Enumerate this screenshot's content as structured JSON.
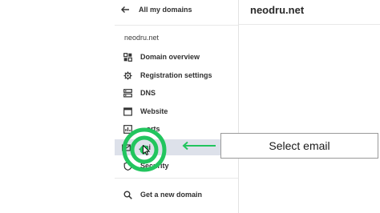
{
  "header": {
    "back_label": "All my domains",
    "domain_title": "neodru.net"
  },
  "sidebar": {
    "section_label": "neodru.net",
    "items": [
      {
        "label": "Domain overview",
        "icon": "domain-overview-icon"
      },
      {
        "label": "Registration settings",
        "icon": "gear-icon"
      },
      {
        "label": "DNS",
        "icon": "dns-icon"
      },
      {
        "label": "Website",
        "icon": "website-icon"
      },
      {
        "label": "...orts",
        "icon": "reports-icon"
      },
      {
        "label": "...ai",
        "icon": "email-icon"
      },
      {
        "label": "Security",
        "icon": "shield-icon"
      }
    ],
    "get_domain_label": "Get a new domain"
  },
  "annotation": {
    "callout_text": "Select email",
    "highlight_color": "#22c55e",
    "arrow_color": "#22c55e"
  },
  "colors": {
    "active_bg": "#dde1ea",
    "divider": "#e3e3e3"
  }
}
